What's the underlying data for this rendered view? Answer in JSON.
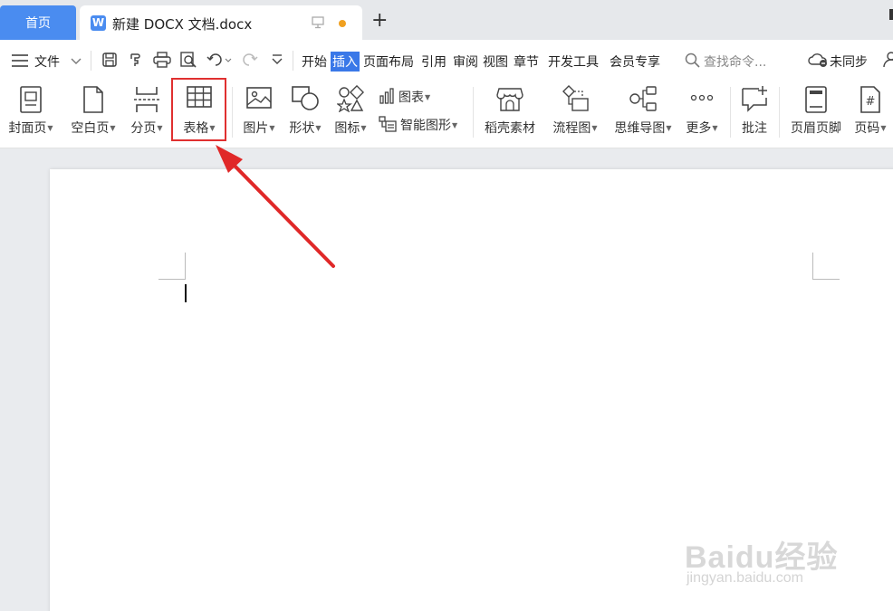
{
  "tabs": {
    "home": "首页",
    "document_title": "新建 DOCX 文档.docx",
    "doc_icon_letter": "W",
    "add": "+"
  },
  "menu": {
    "file": "文件",
    "items": [
      "开始",
      "插入",
      "页面布局",
      "引用",
      "审阅",
      "视图",
      "章节",
      "开发工具",
      "会员专享"
    ],
    "active": "插入",
    "search_placeholder": "查找命令...",
    "sync": "未同步"
  },
  "ribbon": {
    "cover_page": "封面页",
    "blank_page": "空白页",
    "page_break": "分页",
    "table": "表格",
    "picture": "图片",
    "shape": "形状",
    "icon": "图标",
    "chart": "图表",
    "smart_art": "智能图形",
    "daoke_material": "稻壳素材",
    "flowchart": "流程图",
    "mind_map": "思维导图",
    "more": "更多",
    "comment": "批注",
    "header_footer": "页眉页脚",
    "page_number": "页码"
  },
  "watermark": {
    "brand": "Baidu经验",
    "url": "jingyan.baidu.com"
  },
  "colors": {
    "accent": "#4a8cf0",
    "active_tab": "#3a78e8",
    "highlight": "#e03030",
    "unsaved_dot": "#f0a020"
  }
}
